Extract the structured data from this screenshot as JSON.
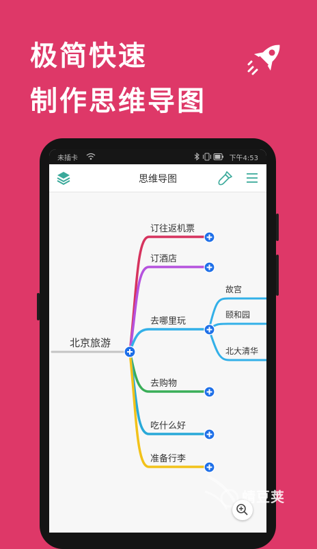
{
  "headline": {
    "line1": "极简快速",
    "line2": "制作思维导图"
  },
  "status_bar": {
    "left": "未插卡",
    "right": "下午4:53"
  },
  "app_bar": {
    "title": "思维导图"
  },
  "mindmap": {
    "root": "北京旅游",
    "branches": [
      {
        "label": "订往返机票",
        "color": "#d6335e"
      },
      {
        "label": "订酒店",
        "color": "#b552de"
      },
      {
        "label": "去哪里玩",
        "color": "#33b0e8",
        "children": [
          "故宫",
          "颐和园",
          "北大清华"
        ]
      },
      {
        "label": "去购物",
        "color": "#3aae58"
      },
      {
        "label": "吃什么好",
        "color": "#29a9d8"
      },
      {
        "label": "准备行李",
        "color": "#f2c21a"
      }
    ]
  },
  "watermark": {
    "text": "蜻豆荚"
  },
  "colors": {
    "background": "#de3868",
    "add_button": "#1e6fe8"
  }
}
